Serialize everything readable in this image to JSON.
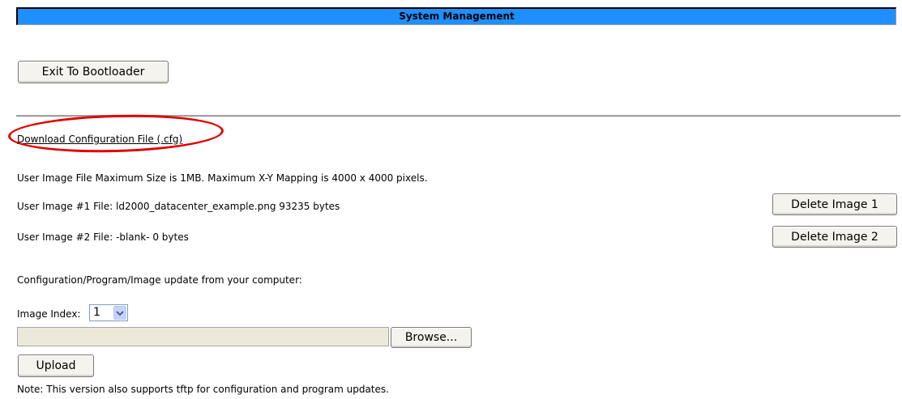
{
  "header": {
    "title": "System Management"
  },
  "buttons": {
    "exit_bootloader": "Exit To Bootloader",
    "delete_image_1": "Delete Image 1",
    "delete_image_2": "Delete Image 2",
    "browse": "Browse...",
    "upload": "Upload"
  },
  "links": {
    "download_config": "Download Configuration File (.cfg)"
  },
  "info": {
    "max_size": "User Image File Maximum Size is 1MB. Maximum X-Y Mapping is 4000 x 4000 pixels.",
    "image1": "User Image #1 File: ld2000_datacenter_example.png 93235 bytes",
    "image2": "User Image #2 File: -blank- 0 bytes",
    "update_from": "Configuration/Program/Image update from your computer:",
    "note": "Note: This version also supports tftp for configuration and program updates."
  },
  "image_index": {
    "label": "Image Index:",
    "selected": "1"
  },
  "file_input": {
    "value": ""
  },
  "annotation": {
    "color": "#e00000"
  },
  "colors": {
    "header_bg": "#1e8fff"
  }
}
